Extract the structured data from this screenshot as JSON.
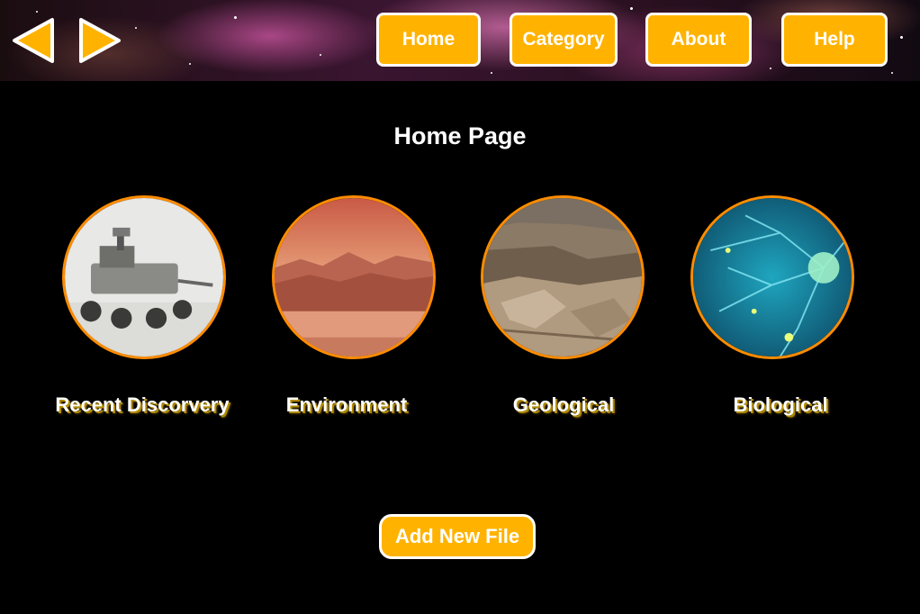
{
  "nav": {
    "back_icon": "back-arrow-icon",
    "forward_icon": "forward-arrow-icon",
    "buttons": [
      {
        "label": "Home"
      },
      {
        "label": "Category"
      },
      {
        "label": "About"
      },
      {
        "label": "Help"
      }
    ]
  },
  "page": {
    "title": "Home Page"
  },
  "categories": [
    {
      "label": "Recent Discorvery",
      "image": "rover-image"
    },
    {
      "label": "Environment",
      "image": "landscape-image"
    },
    {
      "label": "Geological",
      "image": "rock-terrain-image"
    },
    {
      "label": "Biological",
      "image": "neuron-image"
    }
  ],
  "actions": {
    "add_file_label": "Add New File"
  },
  "colors": {
    "accent": "#ffb300",
    "circle_border": "#ff8c00",
    "background": "#000000"
  }
}
